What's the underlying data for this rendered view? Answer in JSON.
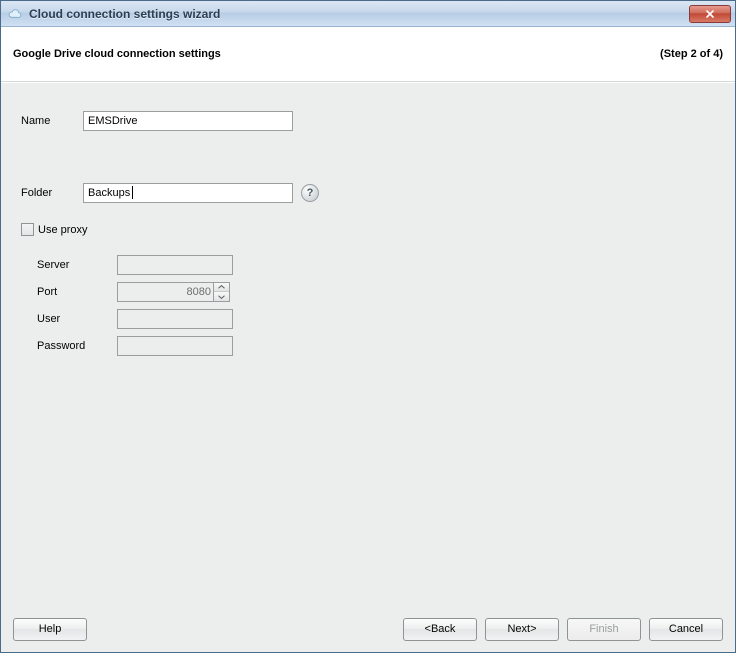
{
  "window": {
    "title": "Cloud connection settings wizard"
  },
  "header": {
    "subtitle": "Google Drive cloud connection settings",
    "step": "(Step 2 of 4)"
  },
  "fields": {
    "name": {
      "label": "Name",
      "value": "EMSDrive"
    },
    "folder": {
      "label": "Folder",
      "value": "Backups"
    },
    "use_proxy": {
      "label": "Use proxy",
      "checked": false
    },
    "proxy": {
      "server": {
        "label": "Server",
        "value": ""
      },
      "port": {
        "label": "Port",
        "value": "8080"
      },
      "user": {
        "label": "User",
        "value": ""
      },
      "password": {
        "label": "Password",
        "value": ""
      }
    }
  },
  "buttons": {
    "help": "Help",
    "back": "<Back",
    "next": "Next>",
    "finish": "Finish",
    "cancel": "Cancel"
  },
  "icons": {
    "cloud": "cloud-icon",
    "close": "close-icon",
    "help_hint": "help-icon",
    "spin_up": "chevron-up-icon",
    "spin_down": "chevron-down-icon"
  }
}
